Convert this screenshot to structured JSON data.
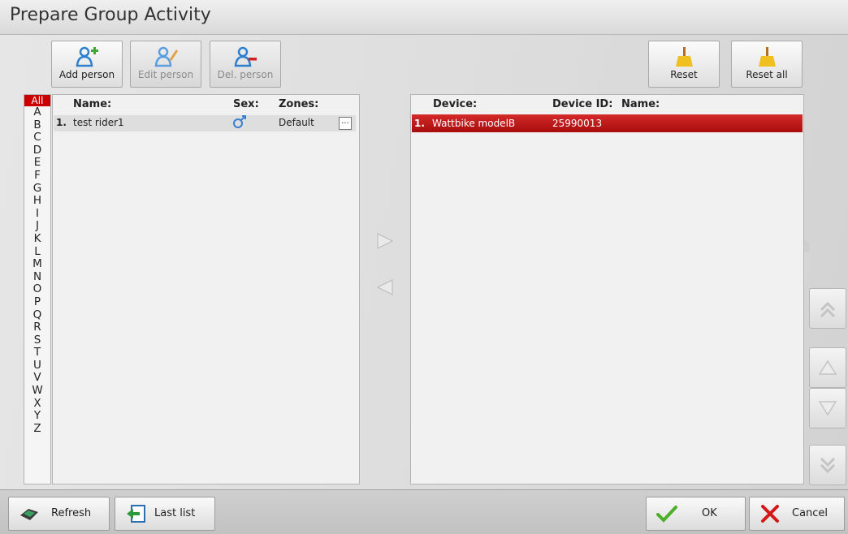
{
  "window": {
    "title": "Prepare Group Activity"
  },
  "toolbar": {
    "add_person": "Add person",
    "edit_person": "Edit person",
    "del_person": "Del. person",
    "reset": "Reset",
    "reset_all": "Reset all"
  },
  "alphabet": {
    "all": "All",
    "letters": [
      "A",
      "B",
      "C",
      "D",
      "E",
      "F",
      "G",
      "H",
      "I",
      "J",
      "K",
      "L",
      "M",
      "N",
      "O",
      "P",
      "Q",
      "R",
      "S",
      "T",
      "U",
      "V",
      "W",
      "X",
      "Y",
      "Z"
    ]
  },
  "persons": {
    "headers": {
      "name": "Name:",
      "sex": "Sex:",
      "zones": "Zones:"
    },
    "rows": [
      {
        "index": "1.",
        "name": "test rider1",
        "sex_icon": "male-icon",
        "zones": "Default",
        "zones_more": "..."
      }
    ]
  },
  "devices": {
    "headers": {
      "device": "Device:",
      "device_id": "Device ID:",
      "name": "Name:"
    },
    "rows": [
      {
        "index": "1.",
        "device": "Wattbike modelB",
        "device_id": "25990013",
        "name": ""
      }
    ]
  },
  "footer": {
    "refresh": "Refresh",
    "last_list": "Last list",
    "ok": "OK",
    "cancel": "Cancel"
  },
  "colors": {
    "selected_row": "#c01818",
    "alpha_selected": "#c80000",
    "ok_check": "#4caf2a",
    "cancel_x": "#d41818"
  }
}
